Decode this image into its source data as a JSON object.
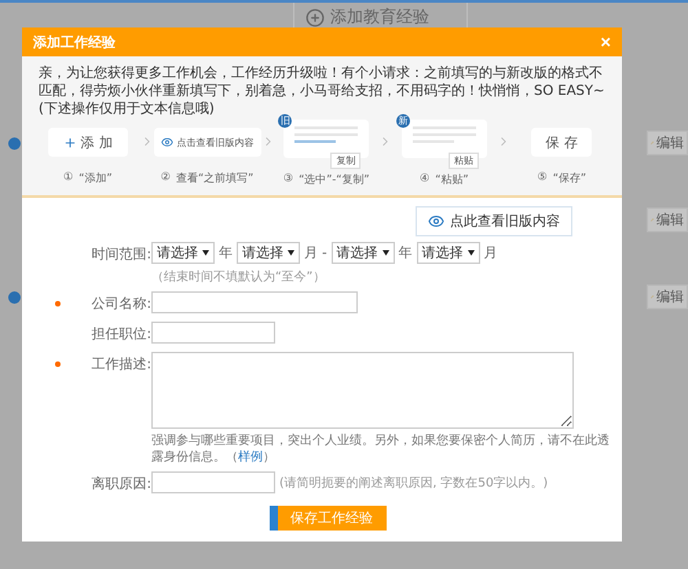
{
  "background": {
    "add_button": "添加教育经验",
    "entries": [
      {
        "bullet": true,
        "edit": "编辑"
      },
      {
        "bullet": false,
        "edit": "编辑"
      },
      {
        "bullet": true,
        "edit": "编辑"
      }
    ]
  },
  "dialog": {
    "title": "添加工作经验",
    "close": "×",
    "intro": "亲，为让您获得更多工作机会，工作经历升级啦！有个小请求：之前填写的与新改版的格式不匹配，得劳烦小伙伴重新填写下，别着急，小马哥给支招，不用码字的！快悄悄，SO EASY~(下述操作仅用于文本信息哦)",
    "steps": [
      {
        "kind": "add",
        "label": "添 加",
        "num": "①",
        "caption": "“添加”"
      },
      {
        "kind": "view",
        "label": "点击查看旧版内容",
        "num": "②",
        "caption": "查看“之前填写”"
      },
      {
        "kind": "doc",
        "badge": "旧",
        "tooltip": "复制",
        "num": "③",
        "caption": "“选中”-“复制”"
      },
      {
        "kind": "doc",
        "badge": "新",
        "tooltip": "粘贴",
        "num": "④",
        "caption": "“粘贴”"
      },
      {
        "kind": "plain",
        "label": "保 存",
        "num": "⑤",
        "caption": "“保存”"
      }
    ],
    "view_old_button": "点此查看旧版内容",
    "date_range": {
      "label": "时间范围:",
      "required": false,
      "parts": [
        {
          "kind": "select",
          "value": "请选择"
        },
        {
          "kind": "unit",
          "text": "年"
        },
        {
          "kind": "select",
          "value": "请选择"
        },
        {
          "kind": "unit",
          "text": "月"
        },
        {
          "kind": "unit",
          "text": "-"
        },
        {
          "kind": "select",
          "value": "请选择"
        },
        {
          "kind": "unit",
          "text": "年"
        },
        {
          "kind": "select",
          "value": "请选择"
        },
        {
          "kind": "unit",
          "text": "月"
        },
        {
          "kind": "note",
          "text": "（结束时间不填默认为“至今”）"
        }
      ]
    },
    "fields": [
      {
        "kind": "long_input",
        "label": "公司名称:",
        "required": true
      },
      {
        "kind": "short_input",
        "label": "担任职位:",
        "required": false
      },
      {
        "kind": "textarea",
        "label": "工作描述:",
        "required": true,
        "hint": "强调参与哪些重要项目，突出个人业绩。另外，如果您要保密个人简历，请不在此透露身份信息。（",
        "link": "样例",
        "hint_end": "）"
      },
      {
        "kind": "short_input",
        "label": "离职原因:",
        "required": false,
        "note": "(请简明扼要的阐述离职原因, 字数在50字以内。)"
      }
    ],
    "save_button": "保存工作经验"
  }
}
